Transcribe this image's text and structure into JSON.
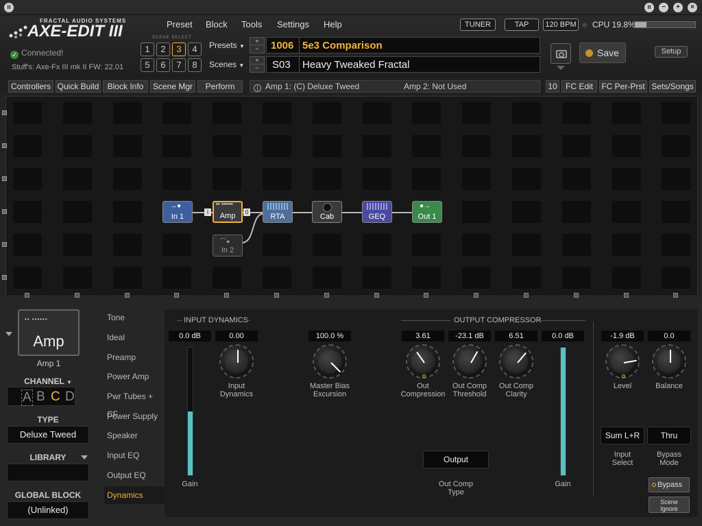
{
  "menu": [
    "Preset",
    "Block",
    "Tools",
    "Settings",
    "Help"
  ],
  "brand": {
    "top": "FRACTAL AUDIO SYSTEMS",
    "name": "AXE-EDIT III"
  },
  "header_buttons": {
    "tuner": "TUNER",
    "tap": "TAP",
    "bpm": "120 BPM",
    "cpu": "CPU 19.8%"
  },
  "cpu_percent": 19.8,
  "connection": {
    "status": "Connected!",
    "device": "Stuff's: Axe-Fx III mk II FW: 22.01"
  },
  "scene_select": {
    "label": "SCENE SELECT",
    "buttons": [
      "1",
      "2",
      "3",
      "4",
      "5",
      "6",
      "7",
      "8"
    ],
    "active": "3"
  },
  "preset": {
    "label": "Presets",
    "number": "1006",
    "name": "5e3 Comparison"
  },
  "scene": {
    "label": "Scenes",
    "number": "S03",
    "name": "Heavy Tweaked Fractal"
  },
  "save_label": "Save",
  "setup_label": "Setup",
  "toolbar": {
    "controllers": "Controllers",
    "quick_build": "Quick Build",
    "block_info": "Block Info",
    "scene_mgr": "Scene Mgr",
    "perform": "Perform",
    "amp1": "Amp 1: (C) Deluxe Tweed",
    "amp2": "Amp 2: Not Used",
    "count": "10",
    "fc_edit": "FC Edit",
    "fc_per_prst": "FC Per-Prst",
    "sets_songs": "Sets/Songs"
  },
  "blocks": {
    "in1": "In 1",
    "amp": "Amp",
    "rta": "RTA",
    "cab": "Cab",
    "geq": "GEQ",
    "out1": "Out 1",
    "in2": "In 2",
    "port_i": "I",
    "port_o": "0"
  },
  "left": {
    "block_title": "Amp",
    "block_sub": "Amp 1",
    "channel_label": "CHANNEL",
    "channels": [
      "A",
      "B",
      "C",
      "D"
    ],
    "channel_selected": "C",
    "type_label": "TYPE",
    "type_value": "Deluxe Tweed",
    "library_label": "LIBRARY",
    "library_value": "",
    "global_label": "GLOBAL BLOCK",
    "global_value": "(Unlinked)"
  },
  "tabs": [
    "Tone",
    "Ideal",
    "Preamp",
    "Power Amp",
    "Pwr Tubes + CF",
    "Power Supply",
    "Speaker",
    "Input EQ",
    "Output EQ",
    "Dynamics"
  ],
  "active_tab": "Dynamics",
  "panel": {
    "input_dynamics_title": "INPUT DYNAMICS",
    "output_comp_title": "OUTPUT COMPRESSOR",
    "gain_in": {
      "value": "0.0 dB",
      "label": "Gain",
      "level": 0.5
    },
    "input_dynamics": {
      "value": "0.00",
      "label1": "Input",
      "label2": "Dynamics"
    },
    "master_bias": {
      "value": "100.0 %",
      "label1": "Master Bias",
      "label2": "Excursion"
    },
    "out_compression": {
      "value": "3.61",
      "label1": "Out",
      "label2": "Compression"
    },
    "out_comp_threshold": {
      "value": "-23.1 dB",
      "label1": "Out Comp",
      "label2": "Threshold"
    },
    "out_comp_clarity": {
      "value": "6.51",
      "label1": "Out Comp",
      "label2": "Clarity"
    },
    "gain_out": {
      "value": "0.0 dB",
      "label": "Gain",
      "level": 1.0
    },
    "level": {
      "value": "-1.9 dB",
      "label": "Level"
    },
    "balance": {
      "value": "0.0",
      "label": "Balance"
    },
    "out_comp_type": {
      "value": "Output",
      "label1": "Out Comp",
      "label2": "Type"
    },
    "input_select": {
      "value": "Sum L+R",
      "label1": "Input",
      "label2": "Select"
    },
    "bypass_mode": {
      "value": "Thru",
      "label1": "Bypass",
      "label2": "Mode"
    },
    "bypass": "Bypass",
    "scene_ignore1": "Scene",
    "scene_ignore2": "Ignore"
  },
  "colors": {
    "accent": "#f2b33a",
    "meter": "#58c2c2",
    "block_blue": "#3d5fa0",
    "block_green": "#3a8a4a",
    "block_purple": "#4a4aa0"
  }
}
